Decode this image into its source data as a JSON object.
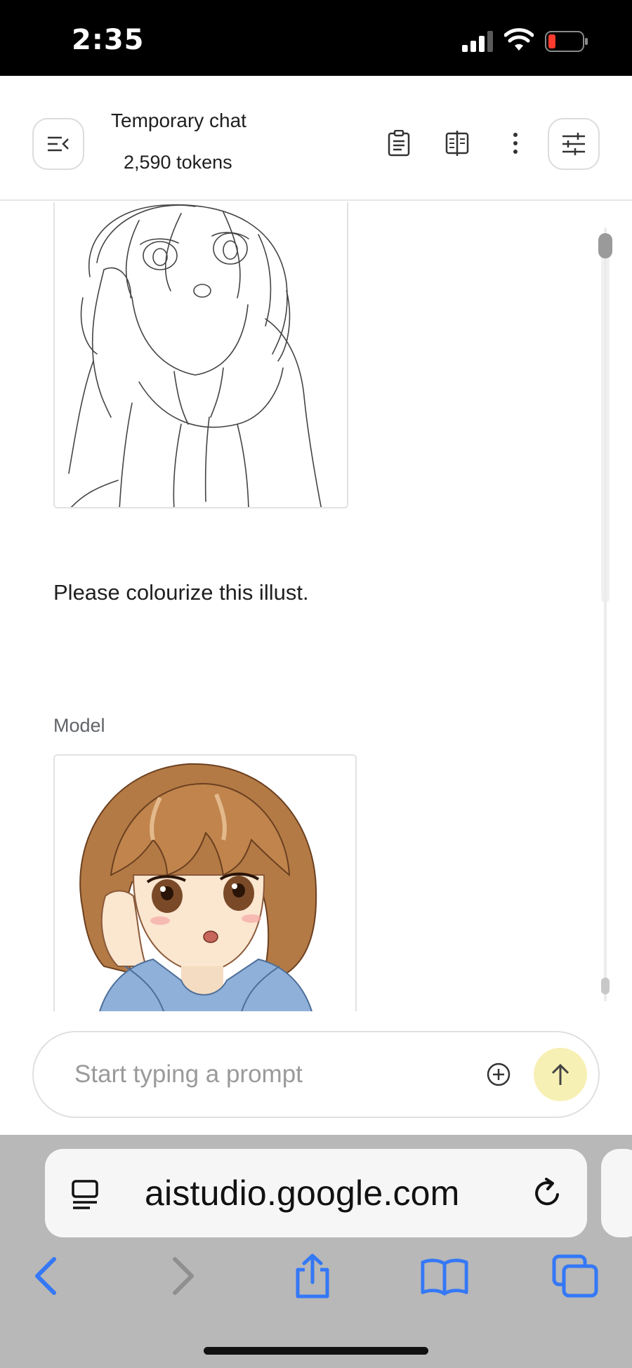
{
  "status_bar": {
    "time": "2:35"
  },
  "header": {
    "title": "Temporary chat",
    "tokens": "2,590 tokens",
    "icons": [
      "menu-collapse-icon",
      "clipboard-icon",
      "compare-icon",
      "more-vert-icon",
      "tune-icon"
    ]
  },
  "chat": {
    "user_message": "Please colourize this illust.",
    "model_label": "Model",
    "user_image": "sketch-image",
    "model_image": "colorized-image"
  },
  "prompt": {
    "placeholder": "Start typing a prompt",
    "icons": [
      "add-circle-icon",
      "arrow-up-icon"
    ]
  },
  "browser": {
    "url": "aistudio.google.com",
    "icons": [
      "page-menu-icon",
      "reload-icon",
      "back-icon",
      "forward-icon",
      "share-icon",
      "bookmarks-icon",
      "tabs-icon"
    ]
  },
  "colors": {
    "send_button": "#f7f0b4",
    "browser_icon": "#3478f6",
    "toolbar_bg": "#b8b8b8"
  }
}
